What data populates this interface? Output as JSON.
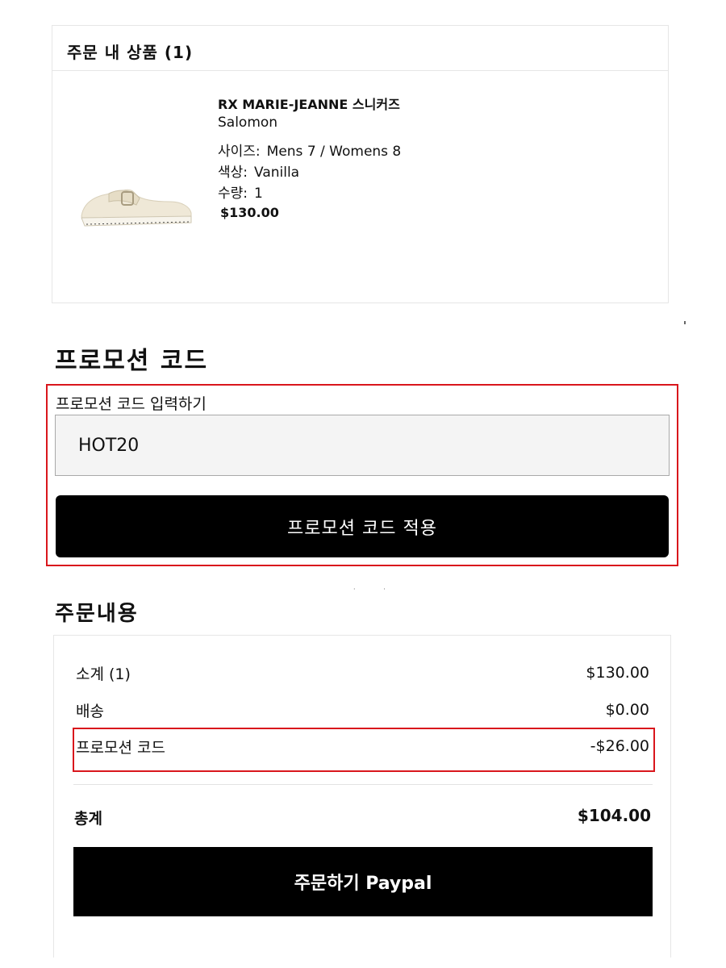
{
  "order_items": {
    "title": "주문 내 상품 (1)",
    "product": {
      "name": "RX MARIE-JEANNE 스니커즈",
      "brand": "Salomon",
      "size_label": "사이즈:",
      "size_value": "Mens 7 / Womens 8",
      "color_label": "색상:",
      "color_value": "Vanilla",
      "qty_label": "수량:",
      "qty_value": "1",
      "price": "$130.00",
      "image_icon": "sneaker-image"
    }
  },
  "promotion": {
    "heading": "프로모션 코드",
    "input_label": "프로모션 코드 입력하기",
    "input_value": "HOT20",
    "apply_label": "프로모션 코드 적용",
    "highlight_color": "#d9161c"
  },
  "summary": {
    "heading": "주문내용",
    "subtotal_label": "소계 (1)",
    "subtotal_value": "$130.00",
    "shipping_label": "배송",
    "shipping_value": "$0.00",
    "promo_label": "프로모션 코드",
    "promo_value": "-$26.00",
    "total_label": "총계",
    "total_value": "$104.00",
    "checkout_label": "주문하기 Paypal"
  }
}
